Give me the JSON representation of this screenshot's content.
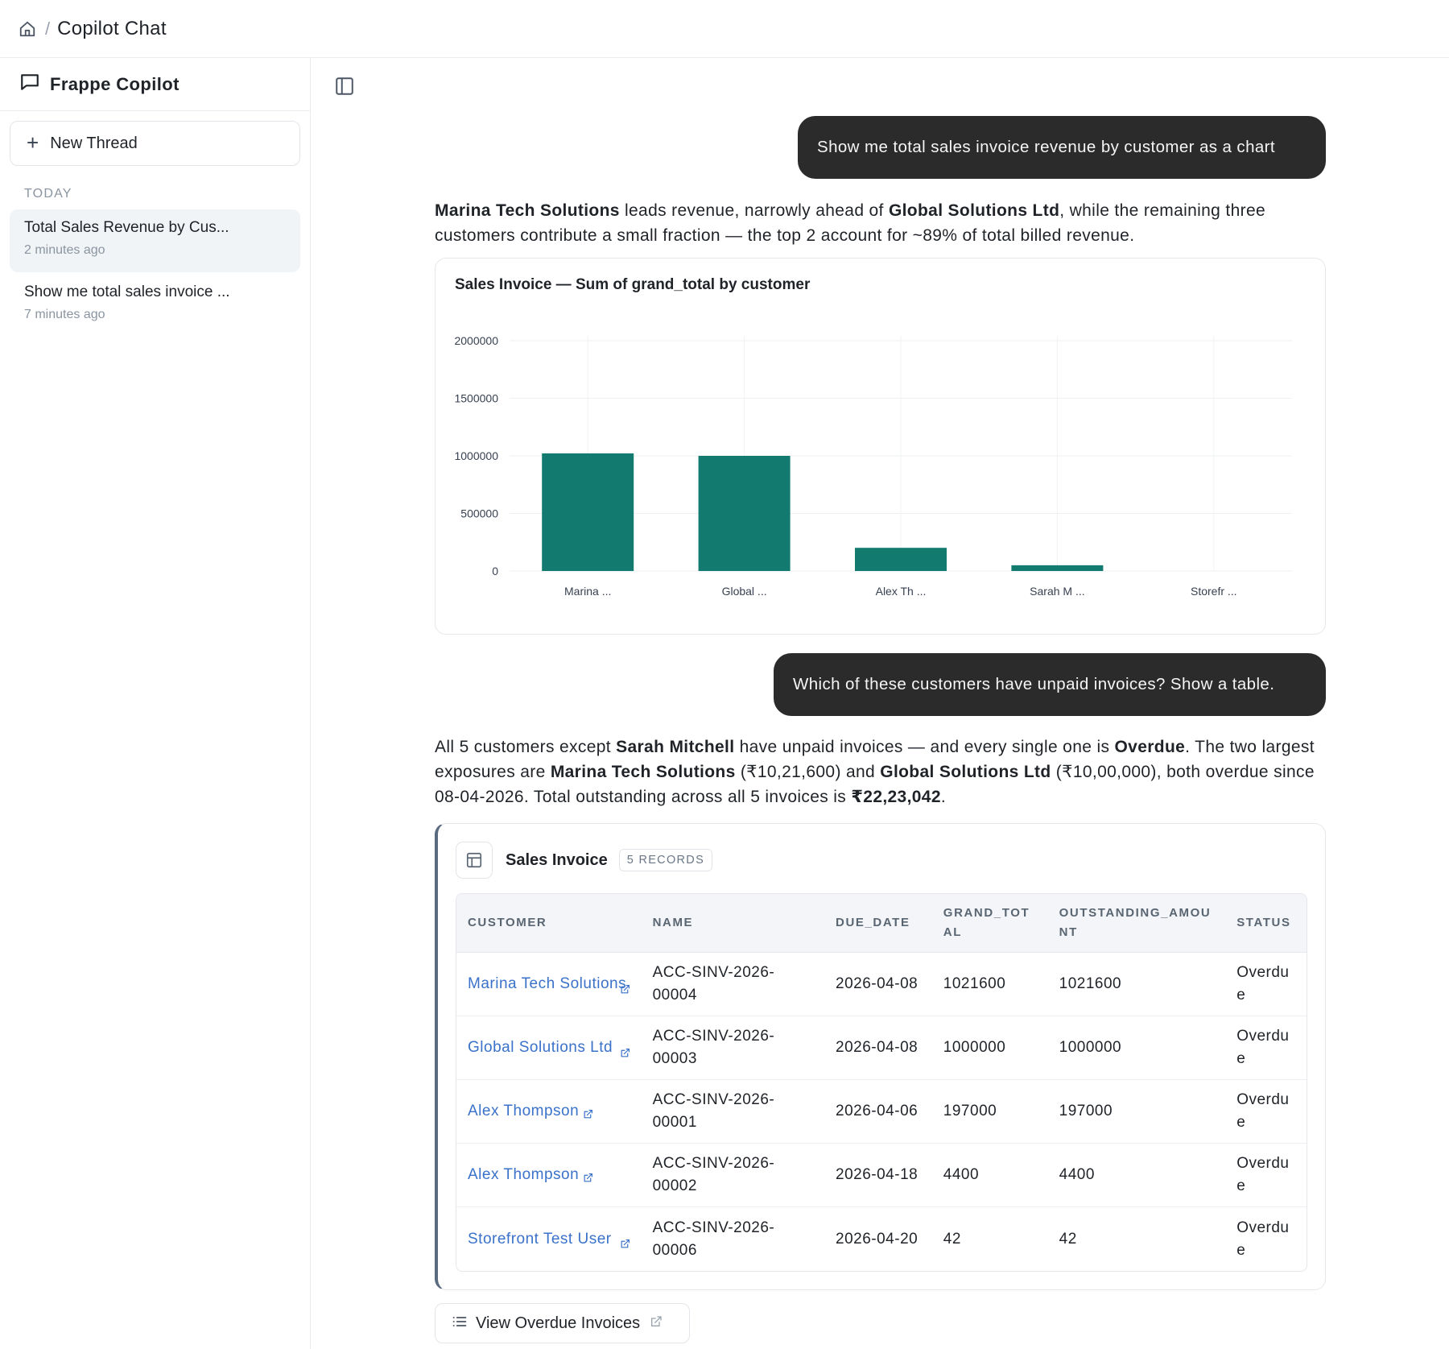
{
  "topbar": {
    "title": "Copilot Chat",
    "separator": "/"
  },
  "sidebar": {
    "brand": "Frappe Copilot",
    "new_thread_label": "New Thread",
    "section_label": "TODAY",
    "threads": [
      {
        "title": "Total Sales Revenue by Cus...",
        "time": "2 minutes ago",
        "active": true
      },
      {
        "title": "Show me total sales invoice ...",
        "time": "7 minutes ago",
        "active": false
      }
    ]
  },
  "conversation": {
    "msg1": "Show me total sales invoice revenue by customer as a chart",
    "reply1": {
      "b1": "Marina Tech Solutions",
      "t1": " leads revenue, narrowly ahead of ",
      "b2": "Global Solutions Ltd",
      "t2": ", while the remaining three customers contribute a small fraction — the top 2 account for ~89% of total billed revenue."
    },
    "msg2": "Which of these customers have unpaid invoices? Show a table.",
    "reply2": {
      "t1": "All 5 customers except ",
      "b1": "Sarah Mitchell",
      "t2": " have unpaid invoices — and every single one is ",
      "b2": "Overdue",
      "t3": ". The two largest exposures are ",
      "b3": "Marina Tech Solutions",
      "t4": " (₹10,21,600) and ",
      "b4": "Global Solutions Ltd",
      "t5": " (₹10,00,000), both overdue since 08-04-2026. Total outstanding across all 5 invoices is ",
      "b5": "₹22,23,042",
      "t6": "."
    }
  },
  "chart_data": {
    "type": "bar",
    "title": "Sales Invoice — Sum of grand_total by customer",
    "categories": [
      "Marina ...",
      "Global ...",
      "Alex Th ...",
      "Sarah M ...",
      "Storefr ..."
    ],
    "values": [
      1021600,
      1000000,
      201400,
      50000,
      42
    ],
    "yticks": [
      0,
      500000,
      1000000,
      1500000,
      2000000
    ],
    "ylim": [
      0,
      2000000
    ],
    "xlabel": "",
    "ylabel": "",
    "grid": true,
    "bar_color": "#127a6f"
  },
  "table_card": {
    "title": "Sales Invoice",
    "badge": "5 RECORDS",
    "columns": [
      "CUSTOMER",
      "NAME",
      "DUE_DATE",
      "GRAND_TOTAL",
      "OUTSTANDING_AMOUNT",
      "STATUS"
    ],
    "rows": [
      {
        "customer": "Marina Tech Solutions",
        "name": "ACC-SINV-2026-00004",
        "due_date": "2026-04-08",
        "grand_total": "1021600",
        "outstanding": "1021600",
        "status": "Overdue"
      },
      {
        "customer": "Global Solutions Ltd",
        "name": "ACC-SINV-2026-00003",
        "due_date": "2026-04-08",
        "grand_total": "1000000",
        "outstanding": "1000000",
        "status": "Overdue"
      },
      {
        "customer": "Alex Thompson",
        "name": "ACC-SINV-2026-00001",
        "due_date": "2026-04-06",
        "grand_total": "197000",
        "outstanding": "197000",
        "status": "Overdue"
      },
      {
        "customer": "Alex Thompson",
        "name": "ACC-SINV-2026-00002",
        "due_date": "2026-04-18",
        "grand_total": "4400",
        "outstanding": "4400",
        "status": "Overdue"
      },
      {
        "customer": "Storefront Test User",
        "name": "ACC-SINV-2026-00006",
        "due_date": "2026-04-20",
        "grand_total": "42",
        "outstanding": "42",
        "status": "Overdue"
      }
    ]
  },
  "view_button_label": "View Overdue Invoices",
  "icons": {
    "home": "home-icon",
    "chat": "chat-icon",
    "plus": "plus-icon",
    "panel": "sidebar-panel-icon",
    "table": "table-icon",
    "external": "external-link-icon",
    "list": "list-icon"
  },
  "colors": {
    "link": "#3a72c9",
    "bubble": "#2b2b2b",
    "accent_bar": "#127a6f"
  }
}
